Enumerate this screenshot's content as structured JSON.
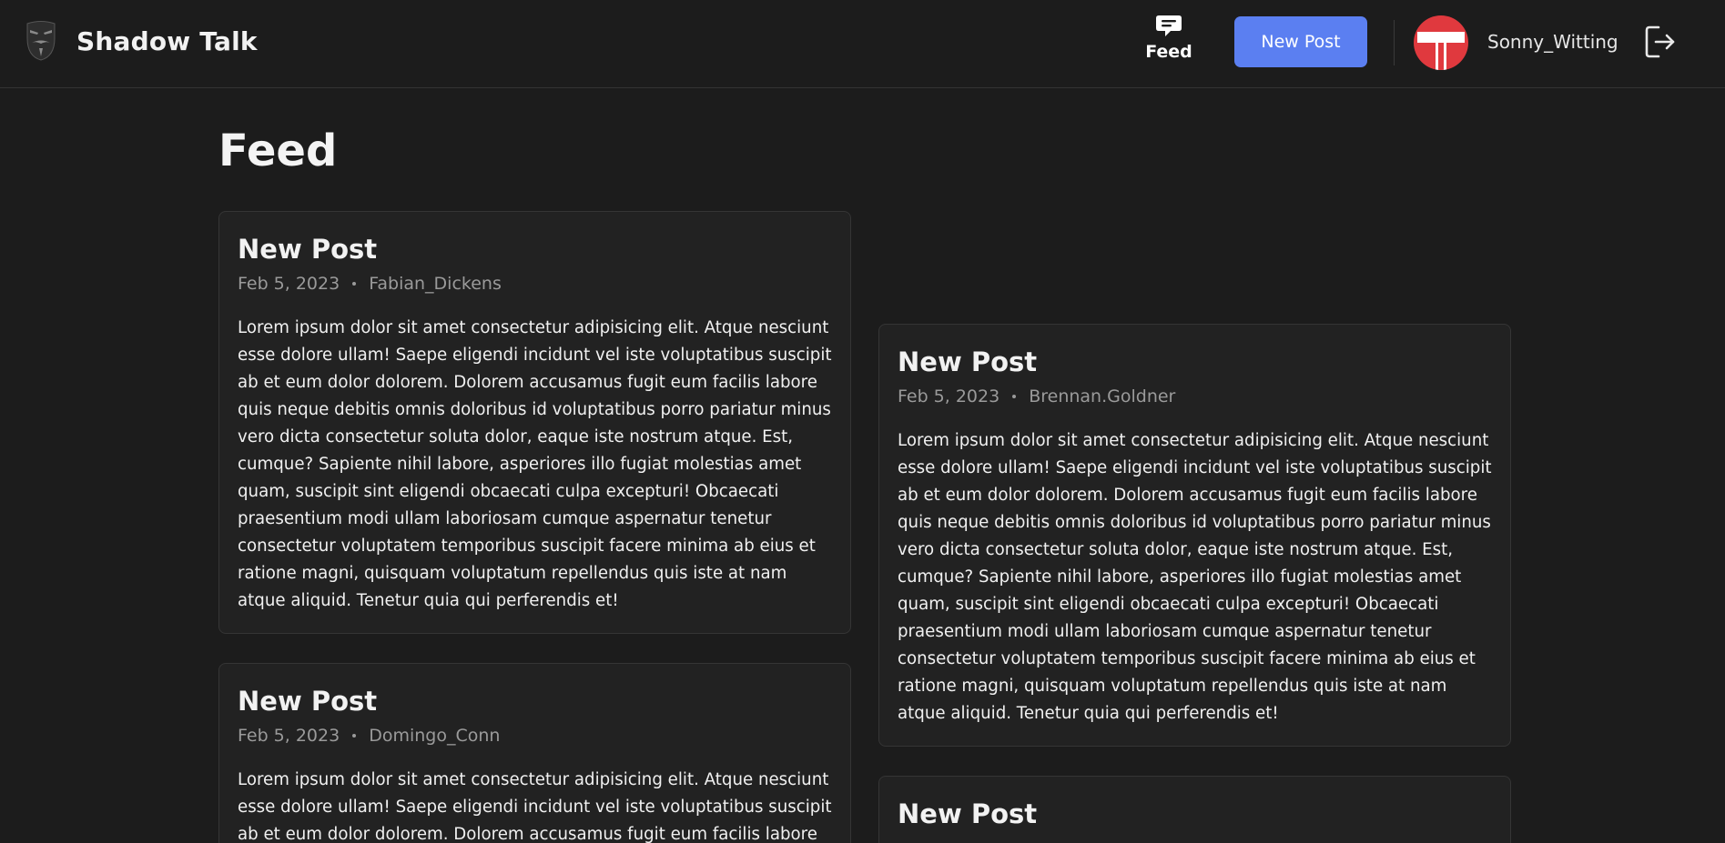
{
  "app": {
    "title": "Shadow Talk"
  },
  "nav": {
    "feed_label": "Feed",
    "new_post_label": "New Post"
  },
  "user": {
    "name": "Sonny_Witting"
  },
  "page": {
    "title": "Feed"
  },
  "colors": {
    "accent": "#5b7ff1",
    "background": "#1c1c1c",
    "card": "#222222",
    "avatar_red": "#e0393e"
  },
  "posts": [
    {
      "title": "New Post",
      "date": "Feb 5, 2023",
      "author": "Fabian_Dickens",
      "body": "Lorem ipsum dolor sit amet consectetur adipisicing elit. Atque nesciunt esse dolore ullam! Saepe eligendi incidunt vel iste voluptatibus suscipit ab et eum dolor dolorem. Dolorem accusamus fugit eum facilis labore quis neque debitis omnis doloribus id voluptatibus porro pariatur minus vero dicta consectetur soluta dolor, eaque iste nostrum atque. Est, cumque? Sapiente nihil labore, asperiores illo fugiat molestias amet quam, suscipit sint eligendi obcaecati culpa excepturi! Obcaecati praesentium modi ullam laboriosam cumque aspernatur tenetur consectetur voluptatem temporibus suscipit facere minima ab eius et ratione magni, quisquam voluptatum repellendus quis iste at nam atque aliquid. Tenetur quia qui perferendis et!"
    },
    {
      "title": "New Post",
      "date": "Feb 5, 2023",
      "author": "Brennan.Goldner",
      "body": "Lorem ipsum dolor sit amet consectetur adipisicing elit. Atque nesciunt esse dolore ullam! Saepe eligendi incidunt vel iste voluptatibus suscipit ab et eum dolor dolorem. Dolorem accusamus fugit eum facilis labore quis neque debitis omnis doloribus id voluptatibus porro pariatur minus vero dicta consectetur soluta dolor, eaque iste nostrum atque. Est, cumque? Sapiente nihil labore, asperiores illo fugiat molestias amet quam, suscipit sint eligendi obcaecati culpa excepturi! Obcaecati praesentium modi ullam laboriosam cumque aspernatur tenetur consectetur voluptatem temporibus suscipit facere minima ab eius et ratione magni, quisquam voluptatum repellendus quis iste at nam atque aliquid. Tenetur quia qui perferendis et!"
    },
    {
      "title": "New Post",
      "date": "Feb 5, 2023",
      "author": "Domingo_Conn",
      "body": "Lorem ipsum dolor sit amet consectetur adipisicing elit. Atque nesciunt esse dolore ullam! Saepe eligendi incidunt vel iste voluptatibus suscipit ab et eum dolor dolorem. Dolorem accusamus fugit eum facilis labore quis"
    },
    {
      "title": "New Post"
    }
  ]
}
